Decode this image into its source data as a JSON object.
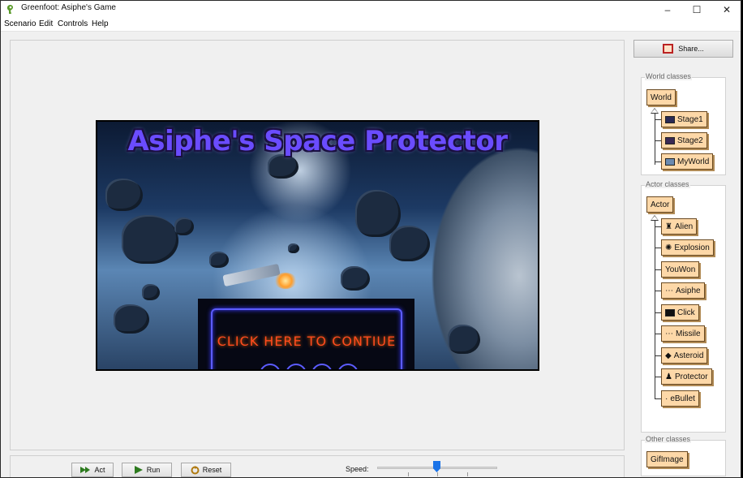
{
  "window": {
    "title": "Greenfoot: Asiphe's Game",
    "controls": {
      "minimize": "–",
      "maximize": "☐",
      "close": "✕"
    }
  },
  "menu": [
    "Scenario",
    "Edit",
    "Controls",
    "Help"
  ],
  "world": {
    "game_title": "Asiphe's Space Protector",
    "button_text": "CLICK HERE TO CONTIUE"
  },
  "sidebar": {
    "share_label": "Share...",
    "world_classes": {
      "label": "World classes",
      "root": "World",
      "children": [
        "Stage1",
        "Stage2",
        "MyWorld"
      ]
    },
    "actor_classes": {
      "label": "Actor classes",
      "root": "Actor",
      "children": [
        "Alien",
        "Explosion",
        "YouWon",
        "Asiphe",
        "Click",
        "Missile",
        "Asteroid",
        "Protector",
        "eBullet"
      ]
    },
    "other_classes": {
      "label": "Other classes",
      "items": [
        "GifImage"
      ]
    }
  },
  "controls": {
    "act_label": "Act",
    "run_label": "Run",
    "reset_label": "Reset",
    "speed_label": "Speed:",
    "speed_fraction": 0.5
  },
  "colors": {
    "class_box": "#fdd8a8",
    "slider_thumb": "#1a73e8",
    "panel_bg": "#f0f0f0"
  }
}
